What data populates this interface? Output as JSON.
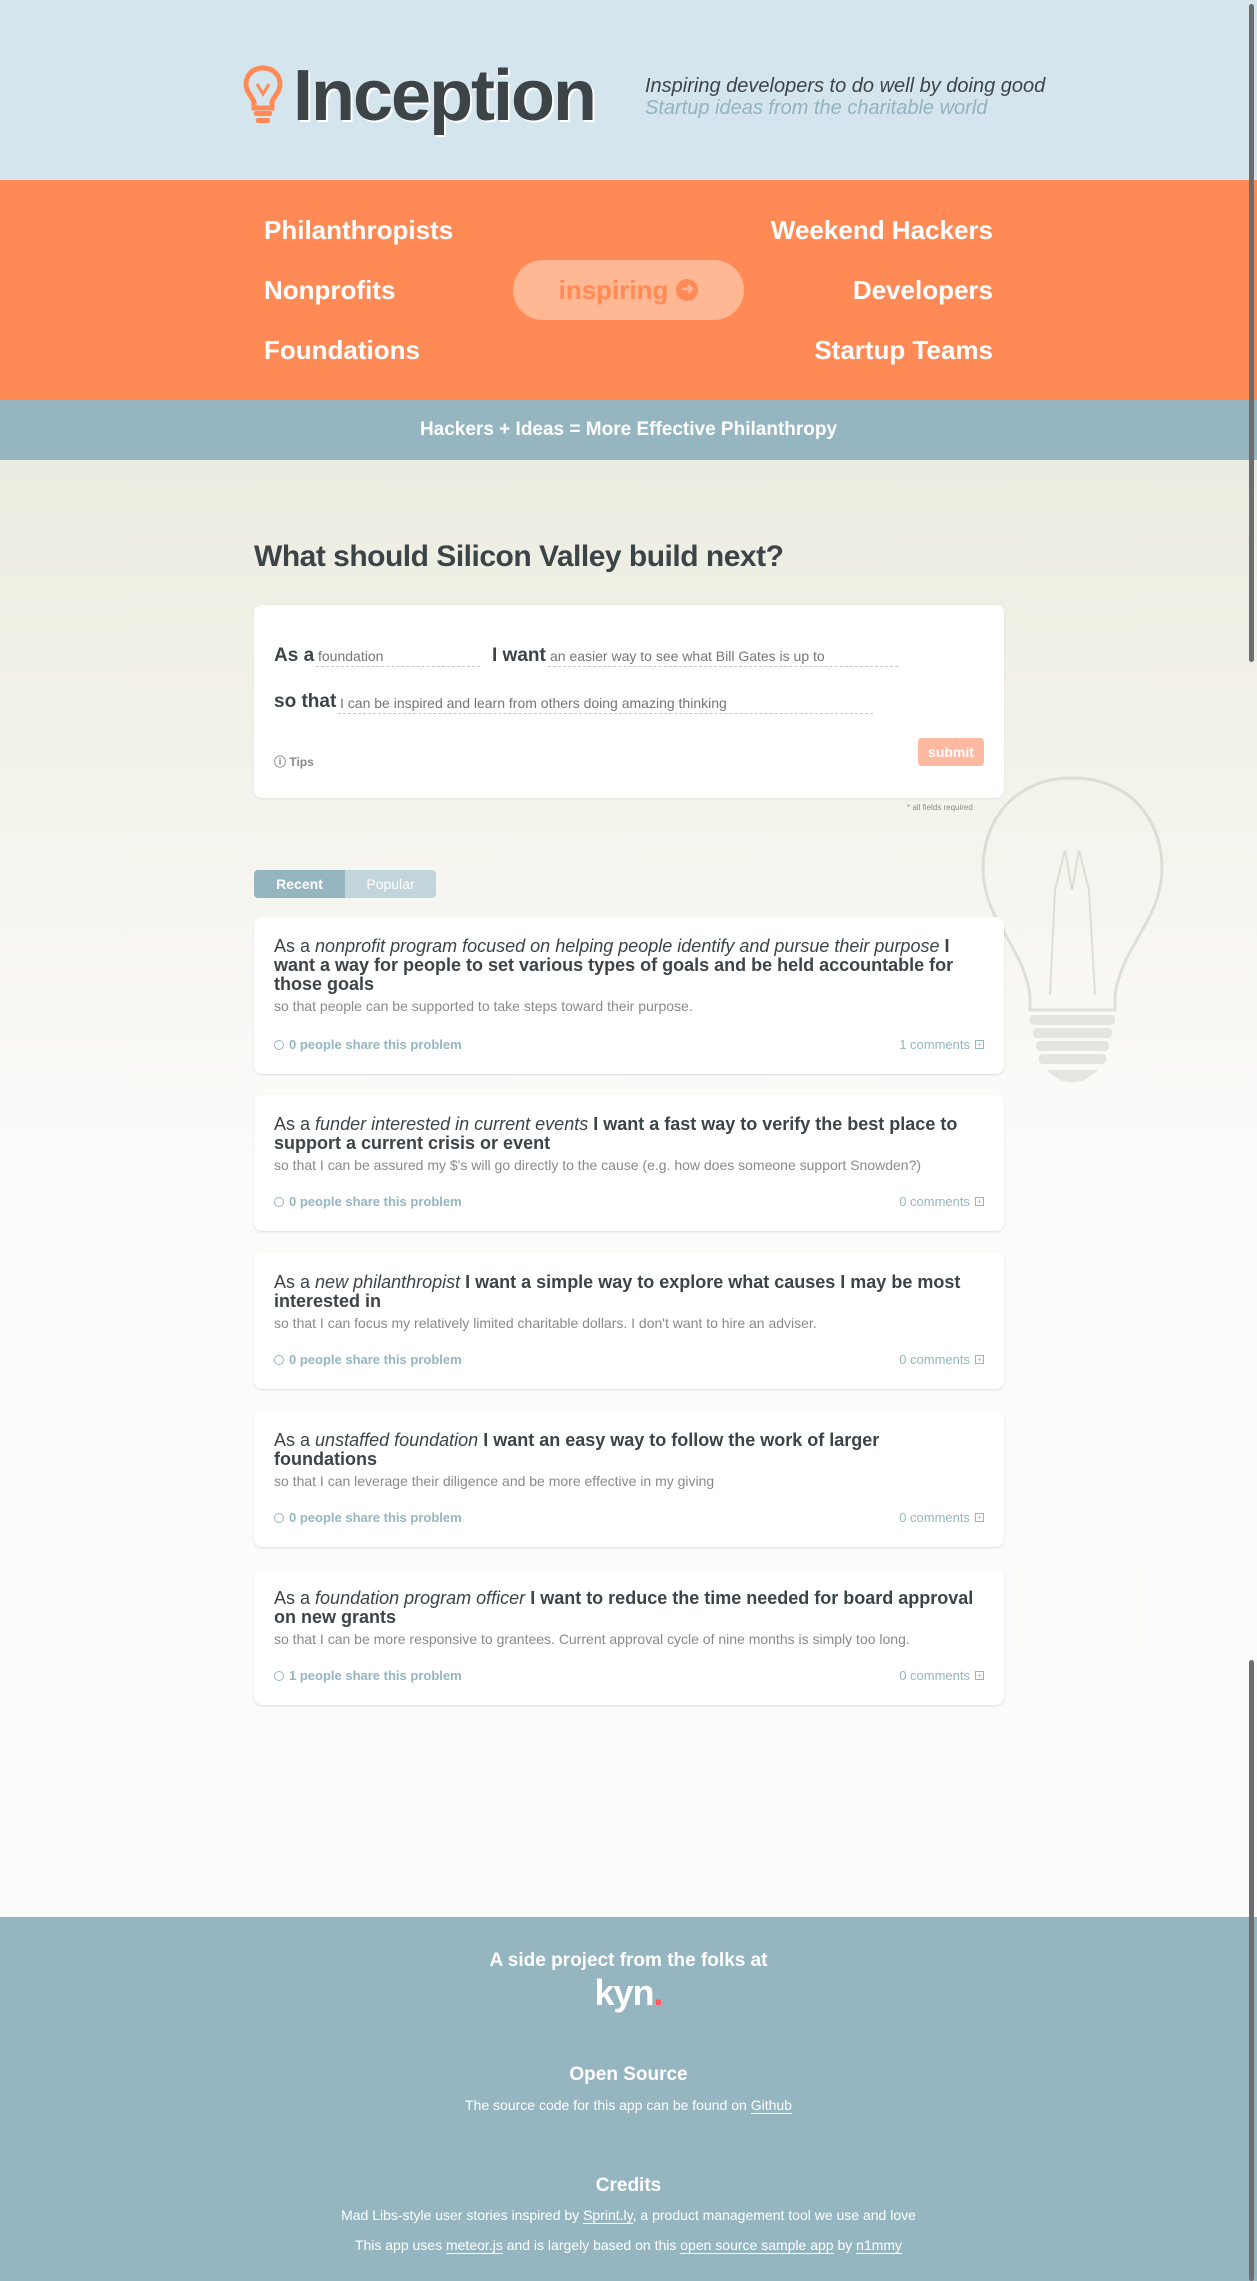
{
  "header": {
    "logo_text": "Inception",
    "tagline_1": "Inspiring developers to do well by doing good",
    "tagline_2": "Startup ideas from the charitable world"
  },
  "audiences": {
    "left": [
      "Philanthropists",
      "Nonprofits",
      "Foundations"
    ],
    "right": [
      "Weekend Hackers",
      "Developers",
      "Startup Teams"
    ],
    "center_button": "inspiring"
  },
  "strip": {
    "text": "Hackers + Ideas = More Effective Philanthropy"
  },
  "question": {
    "title": "What should Silicon Valley build next?",
    "label_as_a": "As a",
    "label_i_want": "I want",
    "label_so_that": "so that",
    "placeholder_who": "foundation",
    "placeholder_want": "an easier way to see what Bill Gates is up to",
    "placeholder_so": "I can be inspired and learn from others doing amazing thinking",
    "tips": "Tips",
    "submit": "submit",
    "required_note": "* all fields required"
  },
  "tabs": {
    "recent": "Recent",
    "popular": "Popular"
  },
  "stories": [
    {
      "as_a": "As a",
      "who": "nonprofit program focused on helping people identify and pursue their purpose",
      "want": "I want a way for people to set various types of goals and be held accountable for those goals",
      "so_that": "so that people can be supported to take steps toward their purpose.",
      "share": "0 people share this problem",
      "comments": "1 comments"
    },
    {
      "as_a": "As a",
      "who": "funder interested in current events",
      "want": "I want a fast way to verify the best place to support a current crisis or event",
      "so_that": "so that I can be assured my $'s will go directly to the cause (e.g. how does someone support Snowden?)",
      "share": "0 people share this problem",
      "comments": "0 comments"
    },
    {
      "as_a": "As a",
      "who": "new philanthropist",
      "want": "I want a simple way to explore what causes I may be most interested in",
      "so_that": "so that I can focus my relatively limited charitable dollars. I don't want to hire an adviser.",
      "share": "0 people share this problem",
      "comments": "0 comments"
    },
    {
      "as_a": "As a",
      "who": "unstaffed foundation",
      "want": "I want an easy way to follow the work of larger foundations",
      "so_that": "so that I can leverage their diligence and be more effective in my giving",
      "share": "0 people share this problem",
      "comments": "0 comments"
    },
    {
      "as_a": "As a",
      "who": "foundation program officer",
      "want": "I want to reduce the time needed for board approval on new grants",
      "so_that": "so that I can be more responsive to grantees. Current approval cycle of nine months is simply too long.",
      "share": "1 people share this problem",
      "comments": "0 comments"
    }
  ],
  "footer": {
    "side_project": "A side project from the folks at",
    "kyn": "kyn",
    "kyn_dot": ".",
    "open_source_title": "Open Source",
    "open_source_text": "The source code for this app can be found on",
    "github_link": "Github",
    "credits_title": "Credits",
    "credits_1a": "Mad Libs-style user stories inspired by",
    "credits_1_link": "Sprint.ly",
    "credits_1b": ", a product management tool we use and love",
    "credits_2a": "This app uses",
    "credits_2_link1": "meteor.js",
    "credits_2b": "and is largely based on this",
    "credits_2_link2": "open source sample app",
    "credits_2c": "by",
    "credits_2_link3": "n1mmy"
  },
  "colors": {
    "accent_orange": "#ff8a56",
    "slate_blue": "#95b6c1",
    "header_bg": "#d4e5ee",
    "text_dark": "#3d4448"
  }
}
